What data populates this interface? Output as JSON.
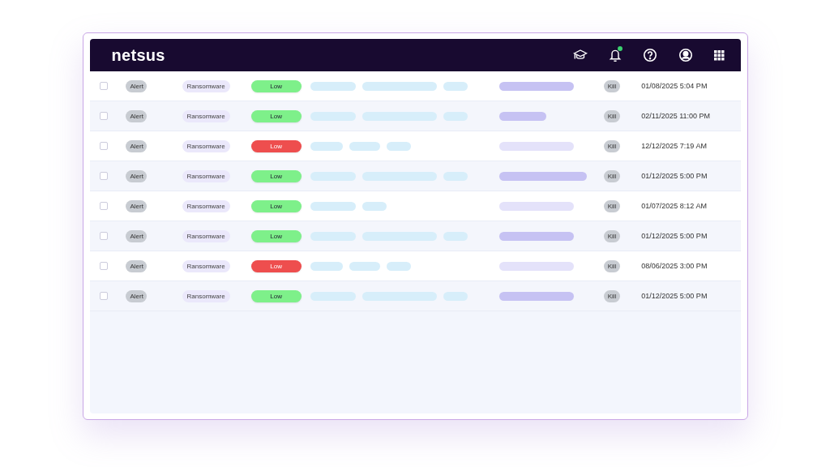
{
  "header": {
    "logo": "netsus"
  },
  "rows": [
    {
      "checked": false,
      "type": "Alert",
      "category": "Ransomware",
      "severity": {
        "label": "Low",
        "color": "#7ef08a"
      },
      "kind": "standard",
      "action": "Kill",
      "time": "01/08/2025 5:04 PM"
    },
    {
      "checked": false,
      "type": "Alert",
      "category": "Ransomware",
      "severity": {
        "label": "Low",
        "color": "#7ef08a"
      },
      "kind": "brief",
      "action": "Kill",
      "time": "02/11/2025 11:00 PM"
    },
    {
      "checked": false,
      "type": "Alert",
      "category": "Ransomware",
      "severity": {
        "label": "Low",
        "color": "#ee4e4e"
      },
      "kind": "compact",
      "action": "Kill",
      "time": "12/12/2025 7:19 AM"
    },
    {
      "checked": false,
      "type": "Alert",
      "category": "Ransomware",
      "severity": {
        "label": "Low",
        "color": "#7ef08a"
      },
      "kind": "extended",
      "action": "Kill",
      "time": "01/12/2025 5:00 PM"
    },
    {
      "checked": false,
      "type": "Alert",
      "category": "Ransomware",
      "severity": {
        "label": "Low",
        "color": "#7ef08a"
      },
      "kind": "muted",
      "action": "Kill",
      "time": "01/07/2025 8:12 AM"
    },
    {
      "checked": false,
      "type": "Alert",
      "category": "Ransomware",
      "severity": {
        "label": "Low",
        "color": "#7ef08a"
      },
      "kind": "standard",
      "action": "Kill",
      "time": "01/12/2025 5:00 PM"
    },
    {
      "checked": false,
      "type": "Alert",
      "category": "Ransomware",
      "severity": {
        "label": "Low",
        "color": "#ee4e4e"
      },
      "kind": "compact",
      "action": "Kill",
      "time": "08/06/2025 3:00 PM"
    },
    {
      "checked": false,
      "type": "Alert",
      "category": "Ransomware",
      "severity": {
        "label": "Low",
        "color": "#7ef08a"
      },
      "kind": "standard",
      "action": "Kill",
      "time": "01/12/2025 5:00 PM"
    }
  ]
}
